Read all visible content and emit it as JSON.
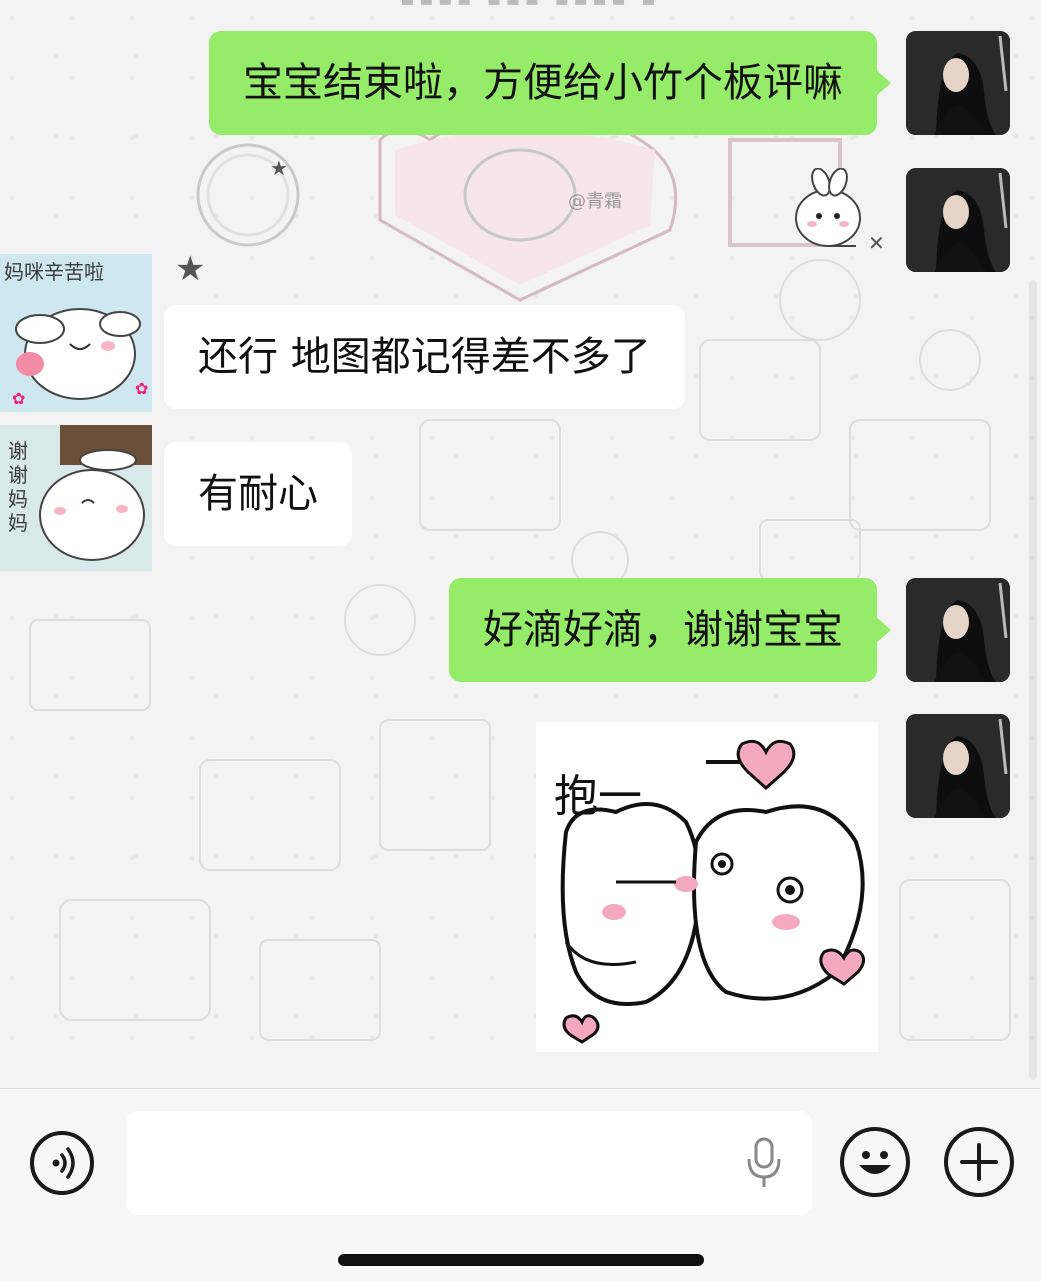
{
  "messages": [
    {
      "side": "right",
      "type": "text",
      "text": "宝宝结束啦，方便给小竹个板评嘛"
    },
    {
      "side": "right",
      "type": "sticker",
      "sticker": "bunny-sticker"
    },
    {
      "side": "left",
      "type": "text",
      "text": "还行 地图都记得差不多了",
      "sticker_caption": "妈咪辛苦啦"
    },
    {
      "side": "left",
      "type": "text",
      "text": "有耐心",
      "sticker_caption": "谢谢妈妈"
    },
    {
      "side": "right",
      "type": "text",
      "text": "好滴好滴，谢谢宝宝"
    },
    {
      "side": "right",
      "type": "sticker",
      "sticker": "hug-sticker",
      "caption": "抱一"
    }
  ],
  "background": {
    "watermark": "@青霜"
  },
  "input_bar": {
    "placeholder": "",
    "icons": [
      "voice-icon",
      "microphone-icon",
      "emoji-icon",
      "plus-icon"
    ]
  },
  "colors": {
    "bubble_self": "#95ec69",
    "bubble_other": "#ffffff",
    "heart": "#f5a9c0"
  }
}
